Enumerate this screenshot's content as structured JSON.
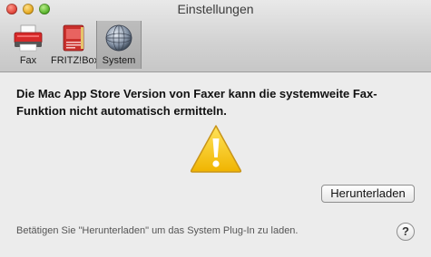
{
  "window": {
    "title": "Einstellungen"
  },
  "toolbar": {
    "items": [
      {
        "label": "Fax",
        "icon": "fax-printer-icon"
      },
      {
        "label": "FRITZ!Box",
        "icon": "fritzbox-icon"
      },
      {
        "label": "System",
        "icon": "system-globe-icon",
        "selected": true
      }
    ]
  },
  "content": {
    "message": "Die Mac App Store Version von Faxer kann die systemweite Fax-Funktion nicht automatisch ermitteln.",
    "download_button": "Herunterladen",
    "hint": "Betätigen Sie \"Herunterladen\" um das System Plug-In zu laden.",
    "help_button": "?"
  },
  "colors": {
    "warning_fill": "#f5c518",
    "warning_stroke": "#c8941a"
  }
}
